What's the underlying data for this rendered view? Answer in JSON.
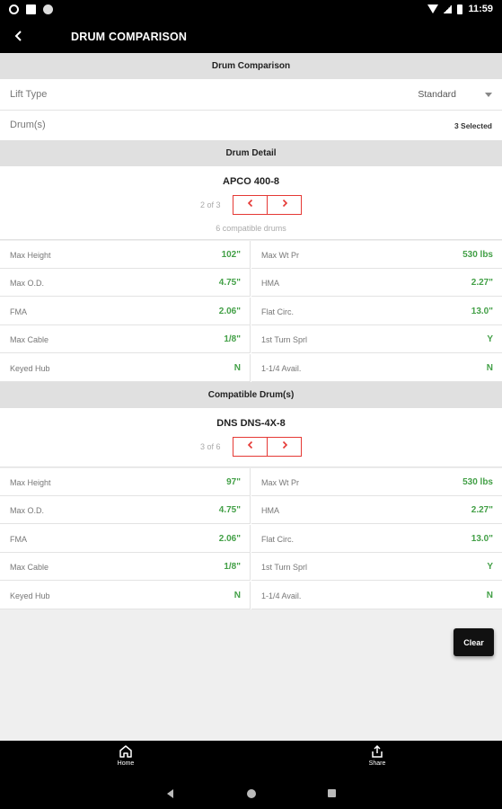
{
  "status_bar": {
    "time": "11:59"
  },
  "app_bar": {
    "title": "DRUM COMPARISON"
  },
  "comparison": {
    "header": "Drum Comparison",
    "lift_type_label": "Lift Type",
    "lift_type_value": "Standard",
    "drums_label": "Drum(s)",
    "drums_value": "3 Selected"
  },
  "detail": {
    "header": "Drum Detail",
    "name": "APCO 400-8",
    "pager_text": "2 of 3",
    "compatible_text": "6 compatible drums",
    "specs": [
      {
        "k1": "Max Height",
        "v1": "102\"",
        "k2": "Max Wt Pr",
        "v2": "530 lbs"
      },
      {
        "k1": "Max O.D.",
        "v1": "4.75\"",
        "k2": "HMA",
        "v2": "2.27\""
      },
      {
        "k1": "FMA",
        "v1": "2.06\"",
        "k2": "Flat Circ.",
        "v2": "13.0\""
      },
      {
        "k1": "Max Cable",
        "v1": "1/8\"",
        "k2": "1st Turn Sprl",
        "v2": "Y"
      },
      {
        "k1": "Keyed Hub",
        "v1": "N",
        "k2": "1-1/4 Avail.",
        "v2": "N"
      }
    ]
  },
  "compatible": {
    "header": "Compatible Drum(s)",
    "name": "DNS DNS-4X-8",
    "pager_text": "3 of 6",
    "specs": [
      {
        "k1": "Max Height",
        "v1": "97\"",
        "k2": "Max Wt Pr",
        "v2": "530 lbs"
      },
      {
        "k1": "Max O.D.",
        "v1": "4.75\"",
        "k2": "HMA",
        "v2": "2.27\""
      },
      {
        "k1": "FMA",
        "v1": "2.06\"",
        "k2": "Flat Circ.",
        "v2": "13.0\""
      },
      {
        "k1": "Max Cable",
        "v1": "1/8\"",
        "k2": "1st Turn Sprl",
        "v2": "Y"
      },
      {
        "k1": "Keyed Hub",
        "v1": "N",
        "k2": "1-1/4 Avail.",
        "v2": "N"
      }
    ]
  },
  "clear_label": "Clear",
  "bottom_nav": {
    "home_label": "Home",
    "share_label": "Share"
  },
  "icons": {
    "back": "chevron-left-icon",
    "prev": "chevron-left-icon",
    "next": "chevron-right-icon",
    "home": "home-icon",
    "share": "share-icon"
  },
  "colors": {
    "accent": "#e53935",
    "value_green": "#43a047",
    "bar": "#000000"
  }
}
